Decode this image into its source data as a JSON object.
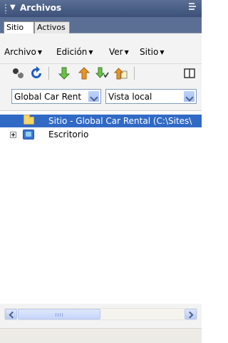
{
  "panel": {
    "title": "Archivos"
  },
  "tabs": [
    {
      "label": "Sitio",
      "active": true
    },
    {
      "label": "Activos",
      "active": false
    }
  ],
  "menu": {
    "items": [
      "Archivo",
      "Edición",
      "Ver",
      "Sitio"
    ]
  },
  "toolbar": {
    "icons": [
      "connect-icon",
      "refresh-icon",
      "get-files-icon",
      "put-files-icon",
      "check-out-icon",
      "check-in-icon",
      "expand-panel-icon"
    ]
  },
  "site_select": {
    "value": "Global Car Rent"
  },
  "view_select": {
    "value": "Vista local"
  },
  "tree": {
    "items": [
      {
        "label": "Sitio - Global Car Rental (C:\\Sites\\",
        "selected": true,
        "icon": "folder-icon"
      },
      {
        "label": "Escritorio",
        "selected": false,
        "icon": "desktop-icon"
      }
    ]
  },
  "colors": {
    "title_bar": "#4a5e84",
    "selection": "#316ac5"
  }
}
